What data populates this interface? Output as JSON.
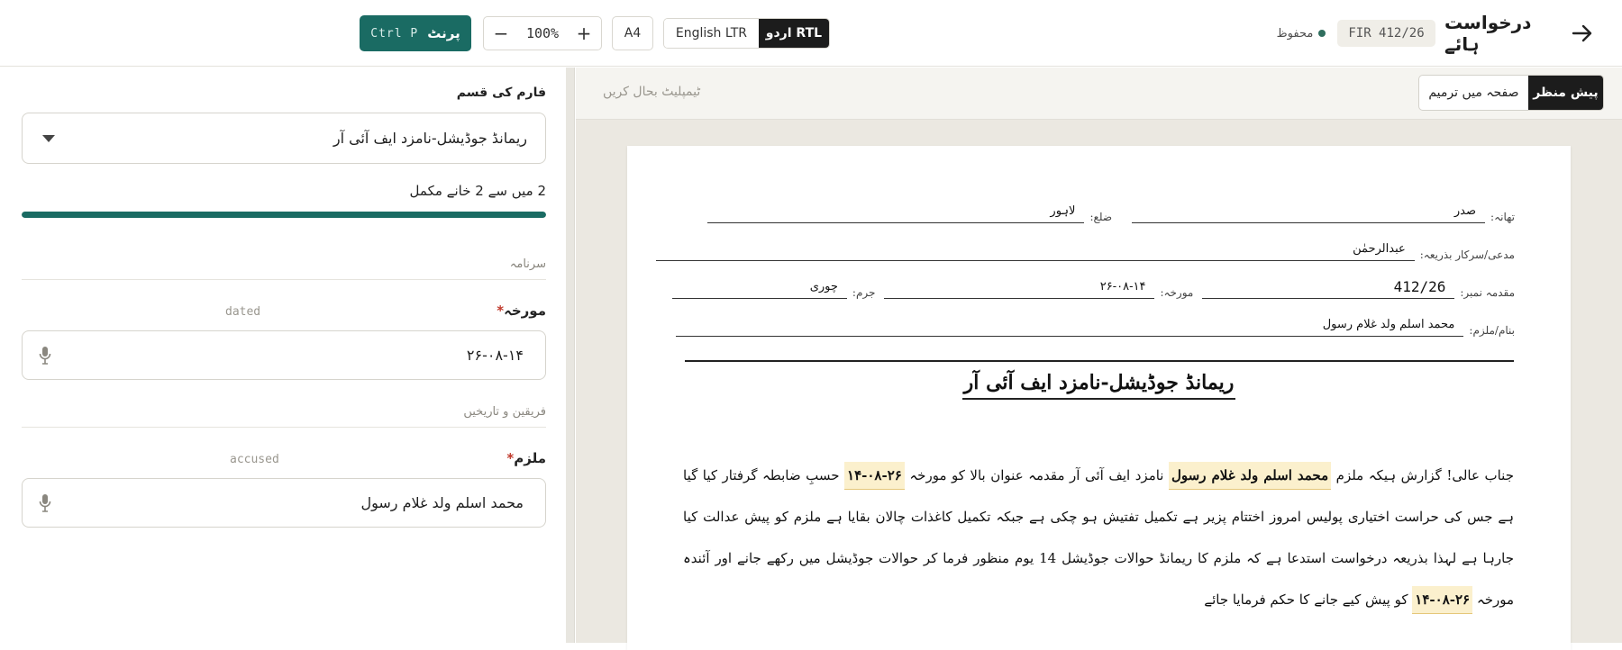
{
  "header": {
    "title": "درخواست ہائے",
    "case_id": "FIR 412/26",
    "saved_label": "محفوظ",
    "lang_rtl": "اردو RTL",
    "lang_ltr": "English LTR",
    "page_size": "A4",
    "zoom_minus": "−",
    "zoom_value": "100%",
    "zoom_plus": "+",
    "print_label": "پرنٹ",
    "print_shortcut": "Ctrl P"
  },
  "form": {
    "type_label": "فارم کی قسم",
    "type_value": "ریمانڈ جوڈیشل-نامزد ایف آئی آر",
    "progress_text": "2 میں سے 2 خانے مکمل",
    "progress_fraction": 1.0,
    "section_heading": "سرنامہ",
    "date_label": "مورخہ",
    "date_hint": "dated",
    "date_value": "۲۶-۰۸-۱۴",
    "section_parties": "فریقین و تاریخیں",
    "accused_label": "ملزم",
    "accused_hint": "accused",
    "accused_value": "محمد اسلم ولد غلام رسول"
  },
  "preview": {
    "reset_label": "ٹیمپلیٹ بحال کریں",
    "tab_edit": "صفحہ میں ترمیم",
    "tab_preview": "پیش منظر"
  },
  "document": {
    "police_station_label": "تھانہ:",
    "police_station": "صدر",
    "district_label": "ضلع:",
    "district": "لاہور",
    "complainant_label": "مدعی/سرکار بذریعہ:",
    "complainant": "عبدالرحمٰن",
    "case_no_label": "مقدمہ نمبر:",
    "case_no": "412/26",
    "dated_label": "مورخہ:",
    "dated": "۲۶-۰۸-۱۴",
    "offence_label": "جرم:",
    "offence": "چوری",
    "accused_label": "بنام/ملزم:",
    "accused": "محمد اسلم ولد غلام رسول",
    "title": "ریمانڈ جوڈیشل-نامزد ایف آئی آر",
    "p1": "جناب عالی! گزارش ہیکہ ملزم",
    "hl_accused": "محمد اسلم ولد غلام رسول",
    "p2": "نامزد ایف آئی آر مقدمہ عنوان بالا کو مورخہ",
    "hl_date1": "۲۶-۰۸-۱۴",
    "p3": "حسبِ ضابطہ گرفتار کیا گیا ہے جس کی حراست اختیاری پولیس امروز اختتام پزیر ہے تکمیل تفتیش ہو چکی ہے جبکہ تکمیل کاغذات چالان بقایا ہے ملزم کو پیش عدالت کیا جارہا ہے لہذا بذریعہ درخواست استدعا ہے کہ ملزم کا ریمانڈ حوالات جوڈیشل 14 یوم منظور فرما کر حوالات جوڈیشل میں رکھے جانے اور آئندہ مورخہ",
    "hl_date2": "۲۶-۰۸-۱۴",
    "p4": "کو پیش کیے جانے کا حکم فرمایا جائے"
  }
}
